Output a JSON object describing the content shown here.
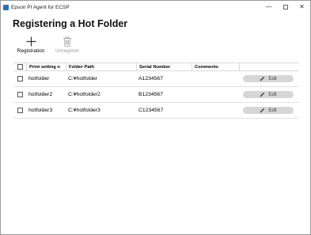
{
  "window": {
    "title": "Epson PI Agent for ECSP",
    "minimize": "—",
    "close": "✕"
  },
  "page": {
    "heading": "Registering a Hot Folder"
  },
  "toolbar": {
    "registration_label": "Registration",
    "unregister_label": "Unregister"
  },
  "table": {
    "headers": [
      "Print setting n",
      "Folder Path",
      "Serial Number",
      "Comments"
    ],
    "rows": [
      {
        "print_setting": "hotfolder",
        "folder_path": "C:¥hotfolder",
        "serial": "A1234567",
        "comments": "",
        "edit_label": "Edit"
      },
      {
        "print_setting": "hotfolder2",
        "folder_path": "C:¥hotfolder2",
        "serial": "B1234567",
        "comments": "",
        "edit_label": "Edit"
      },
      {
        "print_setting": "hotfolder3",
        "folder_path": "C:¥hotfolder3",
        "serial": "C1234567",
        "comments": "",
        "edit_label": "Edit"
      }
    ]
  }
}
